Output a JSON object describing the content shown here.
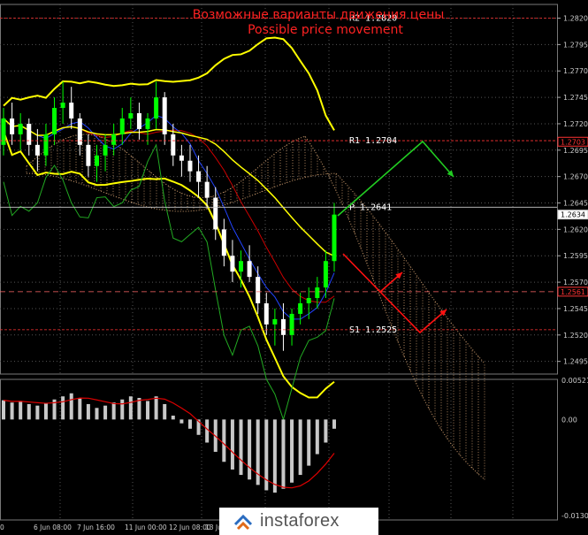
{
  "chart_data": {
    "type": "candlestick",
    "title_ru": "Возможные варианты движения цены",
    "title_en": "Possible price movement",
    "ylim": [
      1.2483,
      1.2833
    ],
    "y_ticks": [
      "1.2820",
      "1.2795",
      "1.2770",
      "1.2745",
      "1.2720",
      "1.2695",
      "1.2670",
      "1.2645",
      "1.2620",
      "1.2595",
      "1.2570",
      "1.2545",
      "1.2520",
      "1.2495"
    ],
    "x_ticks": [
      "0",
      "6 Jun 08:00",
      "7 Jun 16:00",
      "11 Jun 00:00",
      "12 Jun 08:00",
      "13 Ju"
    ],
    "levels": [
      {
        "label": "R2 1.2820",
        "value": 1.282,
        "color": "#ff3333",
        "style": "dash"
      },
      {
        "label": "R1 1.2704",
        "value": 1.2704,
        "color": "#ff3333",
        "style": "dash"
      },
      {
        "label": "P 1.2641",
        "value": 1.2641,
        "color": "#cccccc",
        "style": "solid"
      },
      {
        "label": "S1 1.2525",
        "value": 1.2525,
        "color": "#ff3333",
        "style": "dash"
      }
    ],
    "price_tags": [
      {
        "label": "1.2703",
        "value": 1.2703,
        "color": "#ff3333"
      },
      {
        "label": "1.2634",
        "value": 1.2634,
        "color": "#cccccc"
      },
      {
        "label": "1.2561",
        "value": 1.2561,
        "color": "#ff3333"
      }
    ],
    "hline_dash": 1.2561,
    "macd_ticks": [
      "0.00521",
      "0.00",
      "-0.01305"
    ],
    "macd_range": [
      -0.01305,
      0.00521
    ],
    "candles": [
      [
        1.27,
        1.2735,
        1.269,
        1.2725
      ],
      [
        1.2725,
        1.274,
        1.27,
        1.271
      ],
      [
        1.271,
        1.273,
        1.2695,
        1.272
      ],
      [
        1.272,
        1.2725,
        1.269,
        1.27
      ],
      [
        1.27,
        1.2715,
        1.2675,
        1.269
      ],
      [
        1.269,
        1.272,
        1.268,
        1.271
      ],
      [
        1.271,
        1.2745,
        1.27,
        1.2735
      ],
      [
        1.2735,
        1.276,
        1.272,
        1.274
      ],
      [
        1.274,
        1.2755,
        1.2715,
        1.2725
      ],
      [
        1.2725,
        1.273,
        1.269,
        1.27
      ],
      [
        1.27,
        1.271,
        1.267,
        1.268
      ],
      [
        1.268,
        1.27,
        1.2665,
        1.269
      ],
      [
        1.269,
        1.271,
        1.2675,
        1.27
      ],
      [
        1.27,
        1.272,
        1.269,
        1.271
      ],
      [
        1.271,
        1.2735,
        1.27,
        1.2725
      ],
      [
        1.2725,
        1.2745,
        1.2715,
        1.273
      ],
      [
        1.273,
        1.274,
        1.2705,
        1.2715
      ],
      [
        1.2715,
        1.273,
        1.27,
        1.2725
      ],
      [
        1.2725,
        1.276,
        1.2715,
        1.2745
      ],
      [
        1.2745,
        1.275,
        1.27,
        1.271
      ],
      [
        1.271,
        1.272,
        1.268,
        1.269
      ],
      [
        1.269,
        1.27,
        1.267,
        1.2685
      ],
      [
        1.2685,
        1.27,
        1.2665,
        1.2675
      ],
      [
        1.2675,
        1.269,
        1.265,
        1.2665
      ],
      [
        1.2665,
        1.268,
        1.264,
        1.265
      ],
      [
        1.265,
        1.266,
        1.261,
        1.262
      ],
      [
        1.262,
        1.263,
        1.2585,
        1.2595
      ],
      [
        1.2595,
        1.261,
        1.257,
        1.258
      ],
      [
        1.258,
        1.26,
        1.2565,
        1.259
      ],
      [
        1.259,
        1.2605,
        1.257,
        1.2575
      ],
      [
        1.2575,
        1.2585,
        1.254,
        1.255
      ],
      [
        1.255,
        1.256,
        1.252,
        1.253
      ],
      [
        1.253,
        1.2545,
        1.251,
        1.2535
      ],
      [
        1.2535,
        1.255,
        1.2505,
        1.252
      ],
      [
        1.252,
        1.2545,
        1.251,
        1.254
      ],
      [
        1.254,
        1.256,
        1.253,
        1.255
      ],
      [
        1.255,
        1.2565,
        1.2535,
        1.2555
      ],
      [
        1.2555,
        1.2575,
        1.2545,
        1.2565
      ],
      [
        1.2565,
        1.26,
        1.2555,
        1.259
      ],
      [
        1.259,
        1.2645,
        1.258,
        1.2634
      ]
    ],
    "macd_hist": [
      0.0025,
      0.0022,
      0.0024,
      0.002,
      0.0018,
      0.0021,
      0.0026,
      0.003,
      0.0034,
      0.0028,
      0.002,
      0.0015,
      0.0018,
      0.0022,
      0.0026,
      0.003,
      0.0028,
      0.0024,
      0.003,
      0.002,
      0.0005,
      -0.0005,
      -0.0012,
      -0.002,
      -0.003,
      -0.0042,
      -0.0055,
      -0.0065,
      -0.0072,
      -0.0078,
      -0.0085,
      -0.0092,
      -0.0095,
      -0.009,
      -0.0082,
      -0.0072,
      -0.006,
      -0.0045,
      -0.003,
      -0.0012
    ]
  },
  "logo": {
    "text": "instaforex",
    "icon": "instaforex-logo-icon"
  },
  "colors": {
    "bg": "#000000",
    "grid": "#555555",
    "bull": "#00ff00",
    "bear": "#ffffff",
    "bollinger": "#ffff00",
    "ichimoku": "#d2a070",
    "ma_red": "#cc0000",
    "ma_blue": "#2244ff",
    "ma_green": "#22aa22",
    "arrow_up": "#22cc22",
    "arrow_down": "#ff1111",
    "title": "#ff2222"
  }
}
